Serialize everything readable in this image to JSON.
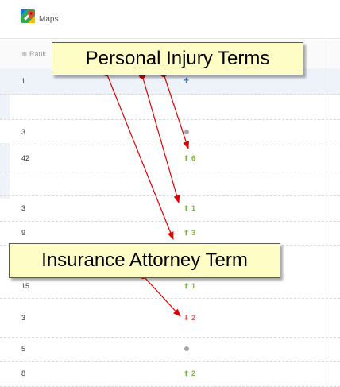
{
  "header": {
    "app_label": "Maps"
  },
  "table": {
    "rank_header": "≑ Rank"
  },
  "rows": [
    {
      "rank": "1",
      "change": "+",
      "change_type": "plus"
    },
    {
      "rank": "",
      "change": "",
      "change_type": "none"
    },
    {
      "rank": "3",
      "change": "",
      "change_type": "dot"
    },
    {
      "rank": "42",
      "change": "⬆ 6",
      "change_type": "up"
    },
    {
      "rank": "",
      "change": "",
      "change_type": "none"
    },
    {
      "rank": "3",
      "change": "⬆ 1",
      "change_type": "up"
    },
    {
      "rank": "9",
      "change": "⬆ 3",
      "change_type": "up"
    },
    {
      "rank": "15",
      "change": "⬆ 1",
      "change_type": "up"
    },
    {
      "rank": "3",
      "change": "⬇ 2",
      "change_type": "down"
    },
    {
      "rank": "5",
      "change": "",
      "change_type": "dot"
    },
    {
      "rank": "8",
      "change": "⬆ 2",
      "change_type": "up"
    }
  ],
  "callouts": {
    "personal_injury": "Personal Injury Terms",
    "insurance_attorney": "Insurance Attorney Term"
  },
  "colors": {
    "up": "#7cb342",
    "down": "#e35b5b",
    "plus": "#4a78b5",
    "callout_bg": "#fdfdc5",
    "arrow": "#e00000"
  },
  "icons": {
    "logo": "google-maps-icon",
    "arrow": "red-arrow-annotation"
  }
}
